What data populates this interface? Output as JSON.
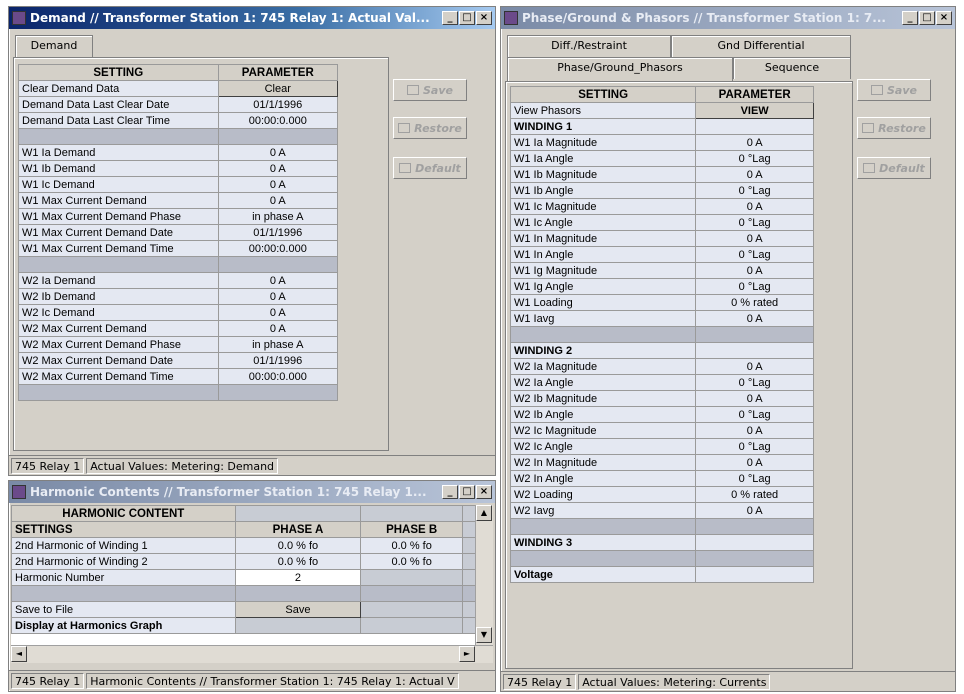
{
  "demand_window": {
    "title": "Demand // Transformer Station 1: 745 Relay 1: Actual Val...",
    "tab": "Demand",
    "headers": {
      "setting": "SETTING",
      "parameter": "PARAMETER"
    },
    "rows": [
      {
        "setting": "Clear Demand Data",
        "value": "Clear",
        "kind": "button"
      },
      {
        "setting": "Demand Data Last Clear Date",
        "value": "01/1/1996",
        "kind": "value"
      },
      {
        "setting": "Demand Data Last Clear Time",
        "value": "00:00:0.000",
        "kind": "value"
      },
      {
        "setting": "",
        "value": "",
        "kind": "blank"
      },
      {
        "setting": "W1 Ia Demand",
        "value": "0 A",
        "kind": "value"
      },
      {
        "setting": "W1 Ib Demand",
        "value": "0 A",
        "kind": "value"
      },
      {
        "setting": "W1 Ic Demand",
        "value": "0 A",
        "kind": "value"
      },
      {
        "setting": "W1 Max Current Demand",
        "value": "0 A",
        "kind": "value"
      },
      {
        "setting": "W1 Max Current Demand Phase",
        "value": "in phase A",
        "kind": "value"
      },
      {
        "setting": "W1 Max Current Demand Date",
        "value": "01/1/1996",
        "kind": "value"
      },
      {
        "setting": "W1 Max Current Demand Time",
        "value": "00:00:0.000",
        "kind": "value"
      },
      {
        "setting": "",
        "value": "",
        "kind": "blank"
      },
      {
        "setting": "W2 Ia Demand",
        "value": "0 A",
        "kind": "value"
      },
      {
        "setting": "W2 Ib Demand",
        "value": "0 A",
        "kind": "value"
      },
      {
        "setting": "W2 Ic Demand",
        "value": "0 A",
        "kind": "value"
      },
      {
        "setting": "W2 Max Current Demand",
        "value": "0 A",
        "kind": "value"
      },
      {
        "setting": "W2 Max Current Demand Phase",
        "value": "in phase A",
        "kind": "value"
      },
      {
        "setting": "W2 Max Current Demand Date",
        "value": "01/1/1996",
        "kind": "value"
      },
      {
        "setting": "W2 Max Current Demand Time",
        "value": "00:00:0.000",
        "kind": "value"
      }
    ],
    "buttons": {
      "save": "Save",
      "restore": "Restore",
      "default": "Default"
    },
    "status": {
      "device": "745 Relay 1",
      "path": "Actual Values: Metering: Demand"
    }
  },
  "harmonic_window": {
    "title": "Harmonic Contents // Transformer Station 1: 745 Relay 1...",
    "section": "HARMONIC CONTENT",
    "headers": {
      "settings": "SETTINGS",
      "phase_a": "PHASE A",
      "phase_b": "PHASE B"
    },
    "rows": [
      {
        "setting": "2nd Harmonic of Winding 1",
        "a": "0.0 % fo",
        "b": "0.0 % fo"
      },
      {
        "setting": "2nd Harmonic of Winding 2",
        "a": "0.0 % fo",
        "b": "0.0 % fo"
      }
    ],
    "harmonic_number": {
      "label": "Harmonic Number",
      "value": "2"
    },
    "save_to_file": {
      "label": "Save to File",
      "button": "Save"
    },
    "display_graph": "Display at Harmonics Graph",
    "status": {
      "device": "745 Relay 1",
      "path": "Harmonic Contents // Transformer Station 1: 745 Relay 1: Actual V"
    }
  },
  "phasor_window": {
    "title": "Phase/Ground & Phasors // Transformer Station 1: 7...",
    "tabs_back": [
      "Diff./Restraint",
      "Gnd Differential"
    ],
    "tabs_front": [
      "Phase/Ground_Phasors",
      "Sequence"
    ],
    "headers": {
      "setting": "SETTING",
      "parameter": "PARAMETER"
    },
    "rows": [
      {
        "setting": "View Phasors",
        "value": "VIEW",
        "kind": "button"
      },
      {
        "setting": "WINDING 1",
        "value": "",
        "kind": "section"
      },
      {
        "setting": "W1 Ia Magnitude",
        "value": "0 A",
        "kind": "value"
      },
      {
        "setting": "W1 Ia Angle",
        "value": "0 °Lag",
        "kind": "value"
      },
      {
        "setting": "W1 Ib Magnitude",
        "value": "0 A",
        "kind": "value"
      },
      {
        "setting": "W1 Ib Angle",
        "value": "0 °Lag",
        "kind": "value"
      },
      {
        "setting": "W1 Ic Magnitude",
        "value": "0 A",
        "kind": "value"
      },
      {
        "setting": "W1 Ic Angle",
        "value": "0 °Lag",
        "kind": "value"
      },
      {
        "setting": "W1 In Magnitude",
        "value": "0 A",
        "kind": "value"
      },
      {
        "setting": "W1 In Angle",
        "value": "0 °Lag",
        "kind": "value"
      },
      {
        "setting": "W1 Ig Magnitude",
        "value": "0 A",
        "kind": "value"
      },
      {
        "setting": "W1 Ig Angle",
        "value": "0 °Lag",
        "kind": "value"
      },
      {
        "setting": "W1 Loading",
        "value": "0 % rated",
        "kind": "value"
      },
      {
        "setting": "W1 Iavg",
        "value": "0 A",
        "kind": "value"
      },
      {
        "setting": "",
        "value": "",
        "kind": "blank"
      },
      {
        "setting": "WINDING 2",
        "value": "",
        "kind": "section"
      },
      {
        "setting": "W2 Ia Magnitude",
        "value": "0 A",
        "kind": "value"
      },
      {
        "setting": "W2 Ia Angle",
        "value": "0 °Lag",
        "kind": "value"
      },
      {
        "setting": "W2 Ib Magnitude",
        "value": "0 A",
        "kind": "value"
      },
      {
        "setting": "W2 Ib Angle",
        "value": "0 °Lag",
        "kind": "value"
      },
      {
        "setting": "W2 Ic Magnitude",
        "value": "0 A",
        "kind": "value"
      },
      {
        "setting": "W2 Ic Angle",
        "value": "0 °Lag",
        "kind": "value"
      },
      {
        "setting": "W2 In Magnitude",
        "value": "0 A",
        "kind": "value"
      },
      {
        "setting": "W2 In Angle",
        "value": "0 °Lag",
        "kind": "value"
      },
      {
        "setting": "W2 Loading",
        "value": "0 % rated",
        "kind": "value"
      },
      {
        "setting": "W2 Iavg",
        "value": "0 A",
        "kind": "value"
      },
      {
        "setting": "",
        "value": "",
        "kind": "blank"
      },
      {
        "setting": "WINDING 3",
        "value": "",
        "kind": "section"
      },
      {
        "setting": "",
        "value": "",
        "kind": "blank"
      },
      {
        "setting": "Voltage",
        "value": "",
        "kind": "section"
      }
    ],
    "buttons": {
      "save": "Save",
      "restore": "Restore",
      "default": "Default"
    },
    "status": {
      "device": "745 Relay 1",
      "path": "Actual Values: Metering: Currents"
    }
  },
  "window_controls": {
    "minimize": "_",
    "maximize": "□",
    "close": "×"
  },
  "icons": {
    "up": "▲",
    "down": "▼",
    "left": "◄",
    "right": "►"
  }
}
